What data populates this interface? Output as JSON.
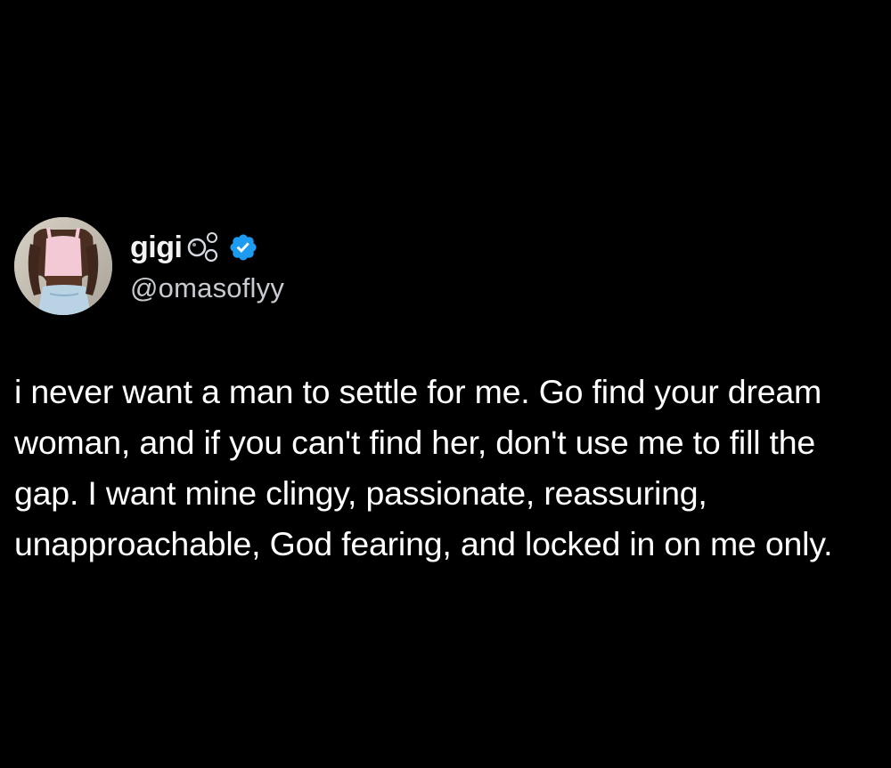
{
  "tweet": {
    "author": {
      "display_name": "gigi",
      "name_decoration_icon": "bubbles-icon",
      "verified_icon": "verified-badge-icon",
      "handle": "@omasoflyy",
      "avatar": "profile-photo"
    },
    "text": "i never want a man to settle for me. Go find your dream woman, and if you can't find her, don't use me to fill the gap. I want mine clingy, passionate, reassuring, unapproachable, God fearing, and locked in on me only."
  },
  "colors": {
    "background": "#000000",
    "text": "#ffffff",
    "handle": "#c7cbcf",
    "verified": "#1d9bf0"
  }
}
